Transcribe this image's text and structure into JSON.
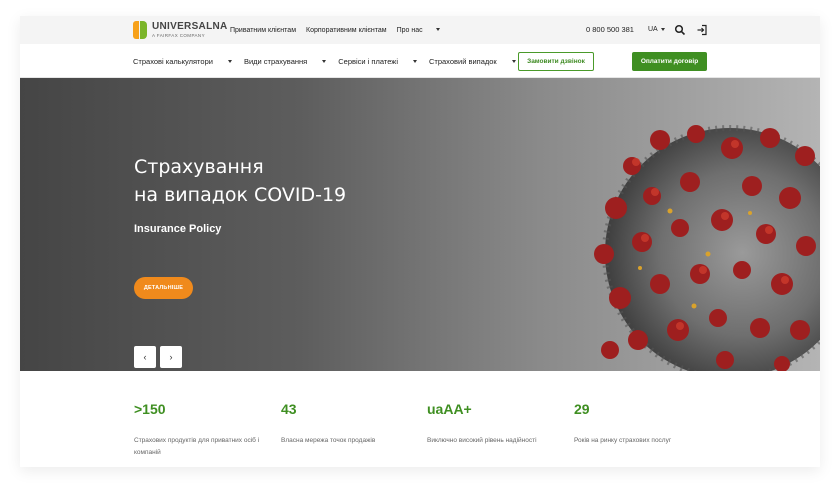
{
  "header": {
    "logo_name": "UNIVERSALNA",
    "logo_sub": "A FAIRFAX COMPANY",
    "links": [
      {
        "label": "Приватним клієнтам"
      },
      {
        "label": "Корпоративним клієнтам"
      },
      {
        "label": "Про нас"
      }
    ],
    "phone": "0 800 500 381",
    "language": "UA"
  },
  "nav": {
    "items": [
      {
        "label": "Страхові калькулятори"
      },
      {
        "label": "Види страхування"
      },
      {
        "label": "Сервіси і платежі"
      },
      {
        "label": "Страховий випадок"
      }
    ],
    "order_call": "Замовити дзвінок",
    "pay_contract": "Оплатити договір"
  },
  "hero": {
    "title_line1": "Страхування",
    "title_line2": "на випадок COVID-19",
    "subtitle": "Insurance Policy",
    "button": "ДЕТАЛЬНІШЕ",
    "prev": "‹",
    "next": "›"
  },
  "stats": [
    {
      "value": ">150",
      "label": "Страхових продуктів для приватних осіб і компаній"
    },
    {
      "value": "43",
      "label": "Власна мережа точок продажів"
    },
    {
      "value": "uaAA+",
      "label": "Виключно високий рівень надійності"
    },
    {
      "value": "29",
      "label": "Років на ринку страхових послуг"
    }
  ],
  "colors": {
    "brand_green": "#3f8f22",
    "brand_orange": "#f08a1c",
    "logo_orange": "#f7a11a",
    "logo_green": "#7bb52a"
  },
  "icons": {
    "search": "search-icon",
    "login": "login-icon"
  }
}
